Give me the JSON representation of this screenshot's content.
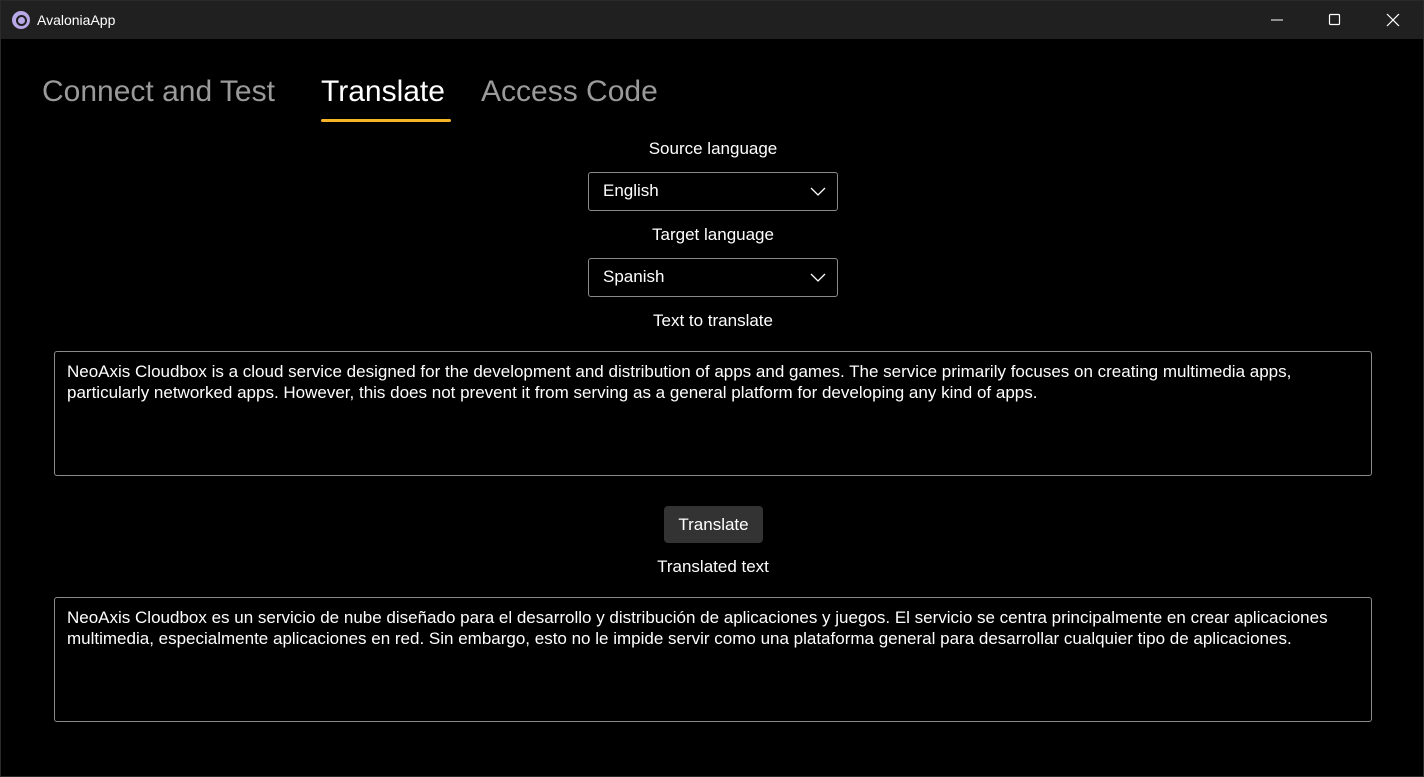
{
  "window": {
    "title": "AvaloniaApp"
  },
  "tabs": [
    {
      "label": "Connect and Test",
      "active": false
    },
    {
      "label": "Translate",
      "active": true
    },
    {
      "label": "Access Code",
      "active": false
    }
  ],
  "translate": {
    "source_language_label": "Source language",
    "source_language_value": "English",
    "target_language_label": "Target language",
    "target_language_value": "Spanish",
    "text_to_translate_label": "Text to translate",
    "text_to_translate": "NeoAxis Cloudbox is a cloud service designed for the development and distribution of apps and games. The service primarily focuses on creating multimedia apps, particularly networked apps. However, this does not prevent it from serving as a general platform for developing any kind of apps.",
    "translate_button_label": "Translate",
    "translated_text_label": "Translated text",
    "translated_text": "NeoAxis Cloudbox es un servicio de nube diseñado para el desarrollo y distribución de aplicaciones y juegos. El servicio se centra principalmente en crear aplicaciones multimedia, especialmente aplicaciones en red. Sin embargo, esto no le impide servir como una plataforma general para desarrollar cualquier tipo de aplicaciones."
  },
  "colors": {
    "accent": "#f5b428",
    "background": "#000000",
    "titlebar": "#202020",
    "inactive_tab": "#9a9a9a"
  },
  "icons": {
    "app": "avalonia-logo-icon",
    "minimize": "minimize-icon",
    "maximize": "maximize-icon",
    "close": "close-icon",
    "dropdown": "chevron-down-icon"
  }
}
